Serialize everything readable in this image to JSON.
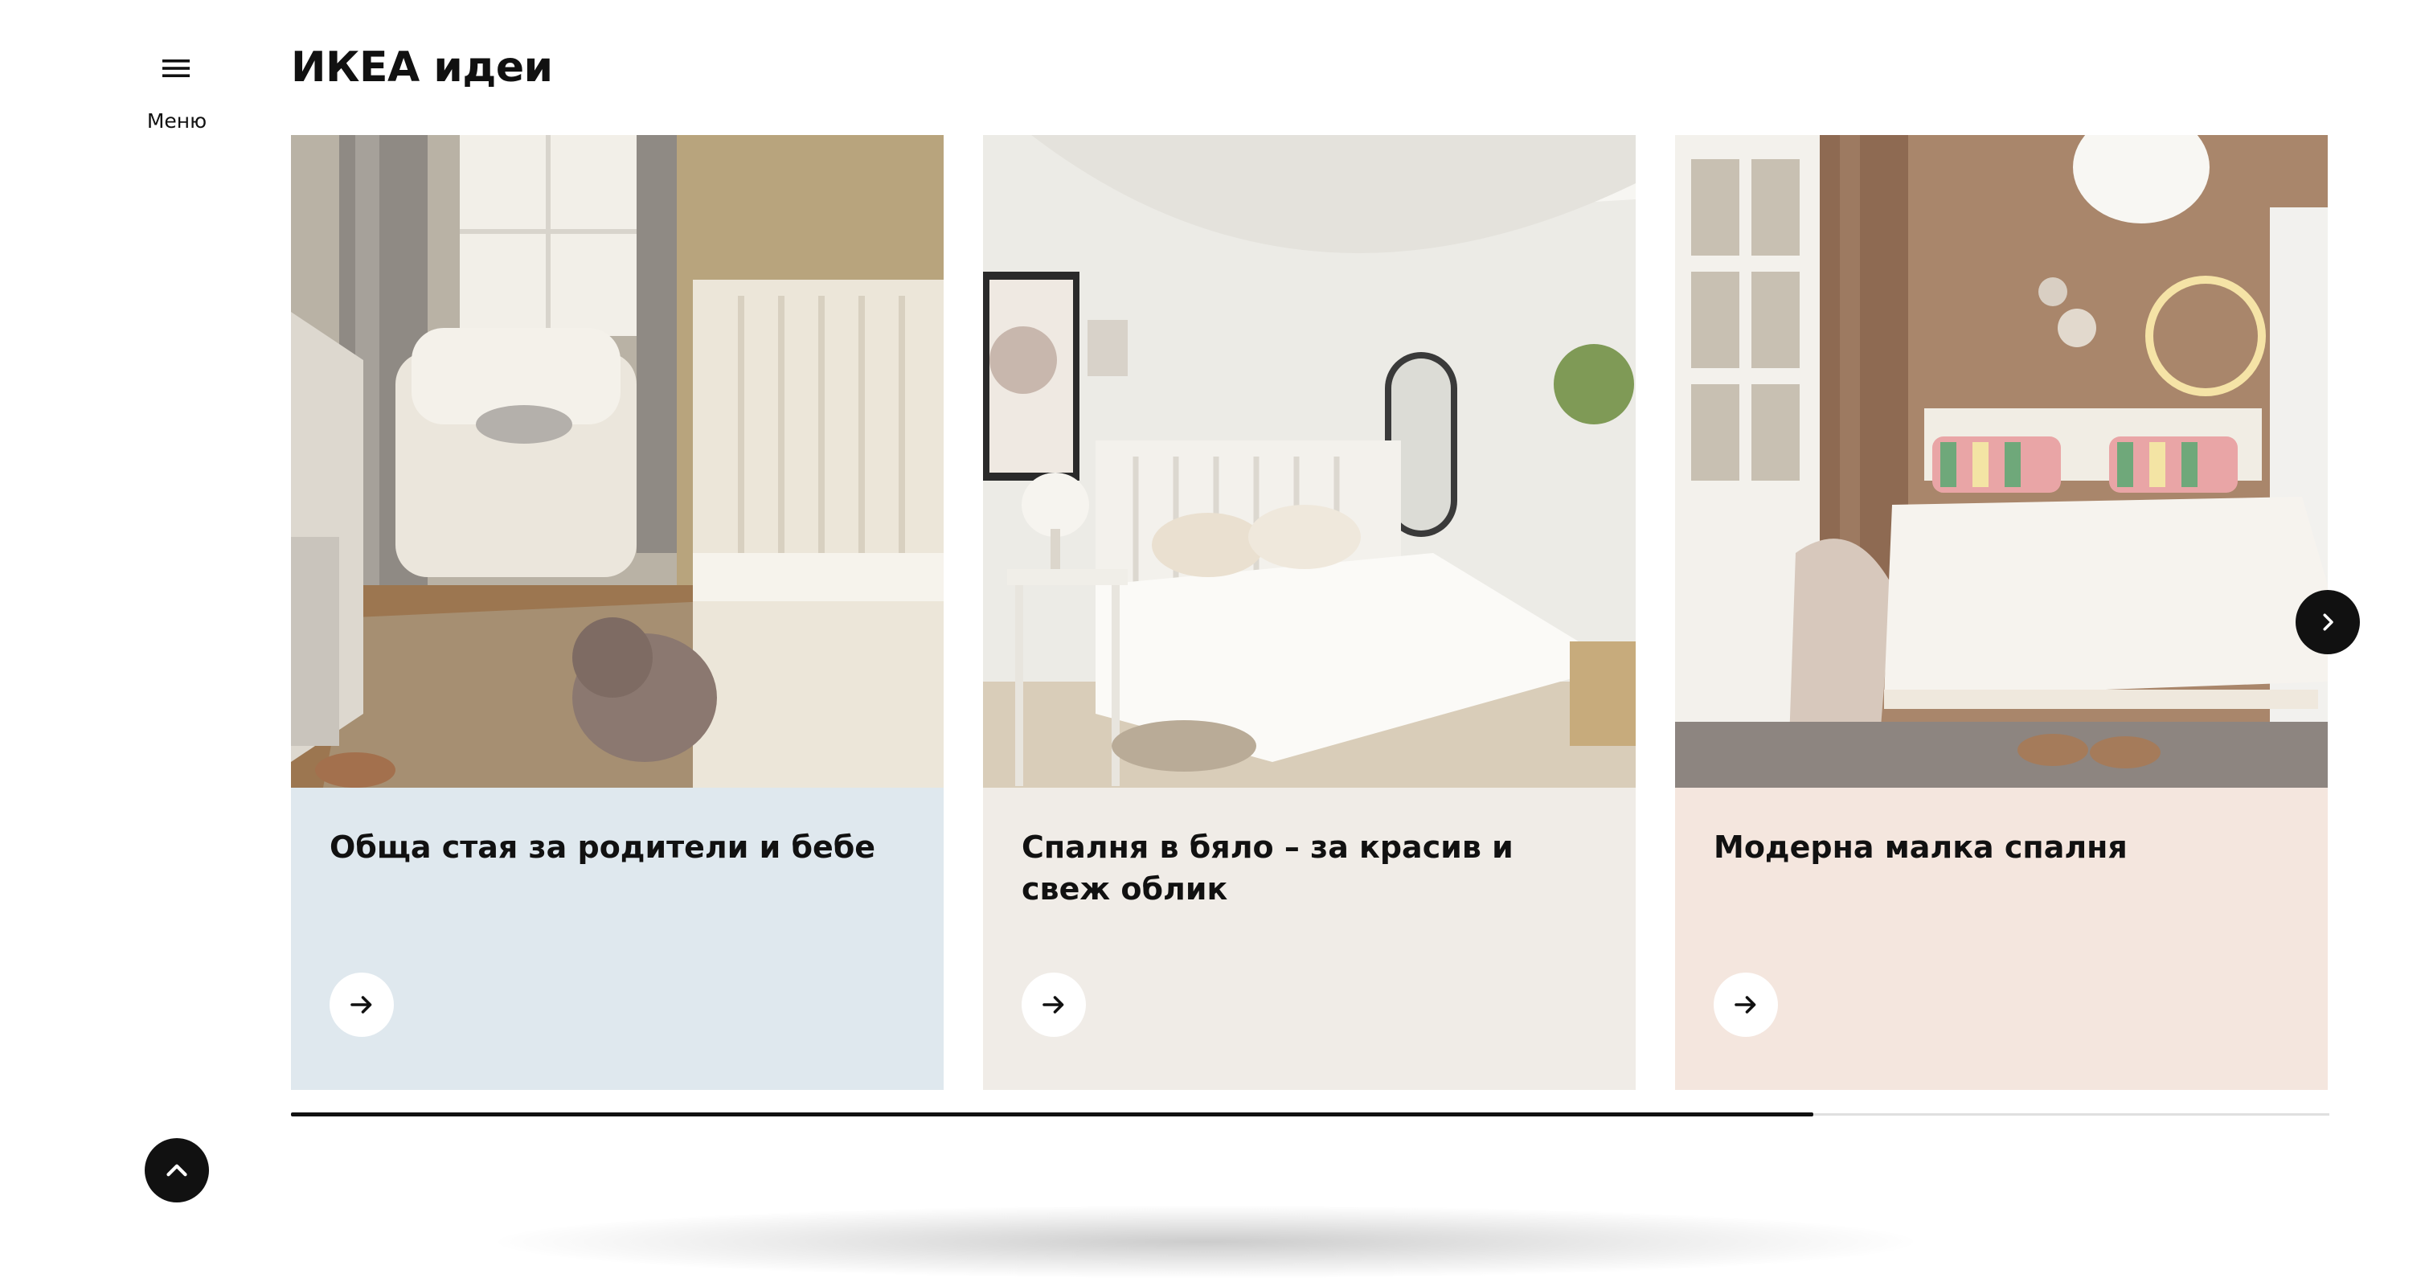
{
  "sidebar": {
    "menu_label": "Меню",
    "menu_icon": "hamburger-icon"
  },
  "page": {
    "title": "ИКЕА идеи"
  },
  "cards": [
    {
      "title": "Обща стая за родители и бебе",
      "background": "#dfe8ee",
      "arrow_icon": "arrow-right-icon"
    },
    {
      "title": "Спалня в бяло – за красив и свеж облик",
      "background": "#f0ece7",
      "arrow_icon": "arrow-right-icon"
    },
    {
      "title": "Модерна малка спалня",
      "background": "#f4e6de",
      "arrow_icon": "arrow-right-icon"
    }
  ],
  "carousel": {
    "next_icon": "chevron-right-icon",
    "scroll_progress": 0.747
  },
  "back_to_top": {
    "icon": "chevron-up-icon"
  }
}
